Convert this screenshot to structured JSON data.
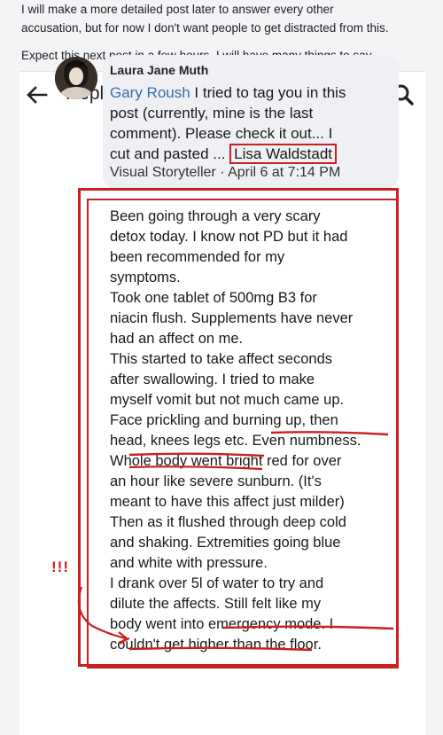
{
  "post": {
    "line1": "I will make a more detailed post later to answer every other",
    "line2": "accusation, but for now I don't want people to get distracted from this.",
    "line3": "Expect this next post in a few hours. I will have many things to say."
  },
  "appbar": {
    "title": "Replies"
  },
  "reply": {
    "author": "Laura Jane Muth",
    "mention": "Gary Roush",
    "text_part1": " I tried to tag you in this",
    "text_line2": "post (currently, mine is the last",
    "text_line3": "comment). Please check it out... I",
    "text_line4_start": "cut and pasted ... ",
    "tagged": "Lisa Waldstadt",
    "meta": "Visual Storyteller · April 6 at 7:14 PM"
  },
  "quoted_post": {
    "lines": [
      "Been going through a very scary",
      "detox today. I know not PD but it had",
      "been recommended for my",
      "symptoms.",
      "Took one tablet of 500mg B3 for",
      "niacin flush. Supplements have never",
      "had an affect on me.",
      "This started to take affect seconds",
      "after swallowing. I tried to make",
      "myself vomit but not much came up.",
      "Face prickling and burning up, then",
      "head, knees legs etc. Even numbness.",
      "Whole body went bright red for over",
      "an hour like severe sunburn. (It's",
      "meant to have this affect just milder)",
      "Then as it flushed through deep cold",
      "and shaking. Extremities going blue",
      "and white with pressure.",
      "I drank over 5l of water to try and",
      "dilute the affects. Still felt like my",
      "body went into emergency mode. I",
      "couldn't get higher than the floor."
    ]
  },
  "annotation": {
    "marks": "!!!"
  },
  "colors": {
    "annotation_red": "#cc1f1f",
    "link_blue": "#3d6aa8",
    "bubble_gray": "#eef0f3"
  },
  "icons": [
    "back-arrow-icon",
    "search-icon"
  ]
}
